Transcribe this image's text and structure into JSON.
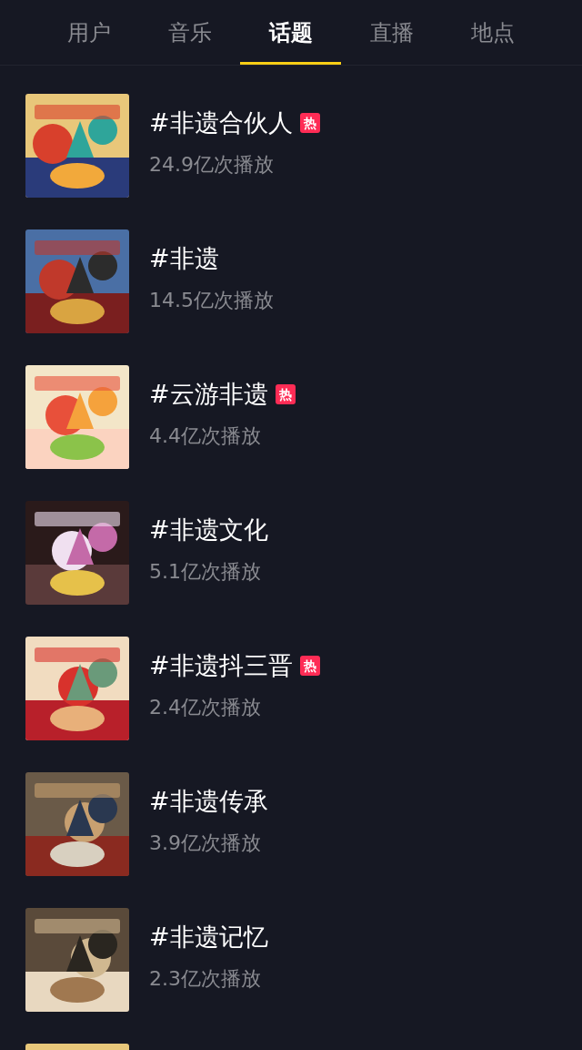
{
  "tabs": [
    {
      "label": "用户",
      "selected": false
    },
    {
      "label": "音乐",
      "selected": false
    },
    {
      "label": "话题",
      "selected": true
    },
    {
      "label": "直播",
      "selected": false
    },
    {
      "label": "地点",
      "selected": false
    }
  ],
  "topics": [
    {
      "thumbnail": {
        "kind": "picture"
      },
      "title": "#非遗合伙人",
      "hot": true,
      "hot_label": "热",
      "plays": "24.9亿次播放"
    },
    {
      "thumbnail": {
        "kind": "picture"
      },
      "title": "#非遗",
      "hot": false,
      "plays": "14.5亿次播放"
    },
    {
      "thumbnail": {
        "kind": "picture"
      },
      "title": "#云游非遗",
      "hot": true,
      "hot_label": "热",
      "plays": "4.4亿次播放"
    },
    {
      "thumbnail": {
        "kind": "picture"
      },
      "title": "#非遗文化",
      "hot": false,
      "plays": "5.1亿次播放"
    },
    {
      "thumbnail": {
        "kind": "picture"
      },
      "title": "#非遗抖三晋",
      "hot": true,
      "hot_label": "热",
      "plays": "2.4亿次播放"
    },
    {
      "thumbnail": {
        "kind": "picture"
      },
      "title": "#非遗传承",
      "hot": false,
      "plays": "3.9亿次播放"
    },
    {
      "thumbnail": {
        "kind": "picture"
      },
      "title": "#非遗记忆",
      "hot": false,
      "plays": "2.3亿次播放"
    },
    {
      "thumbnail": {
        "kind": "picture"
      }
    }
  ]
}
